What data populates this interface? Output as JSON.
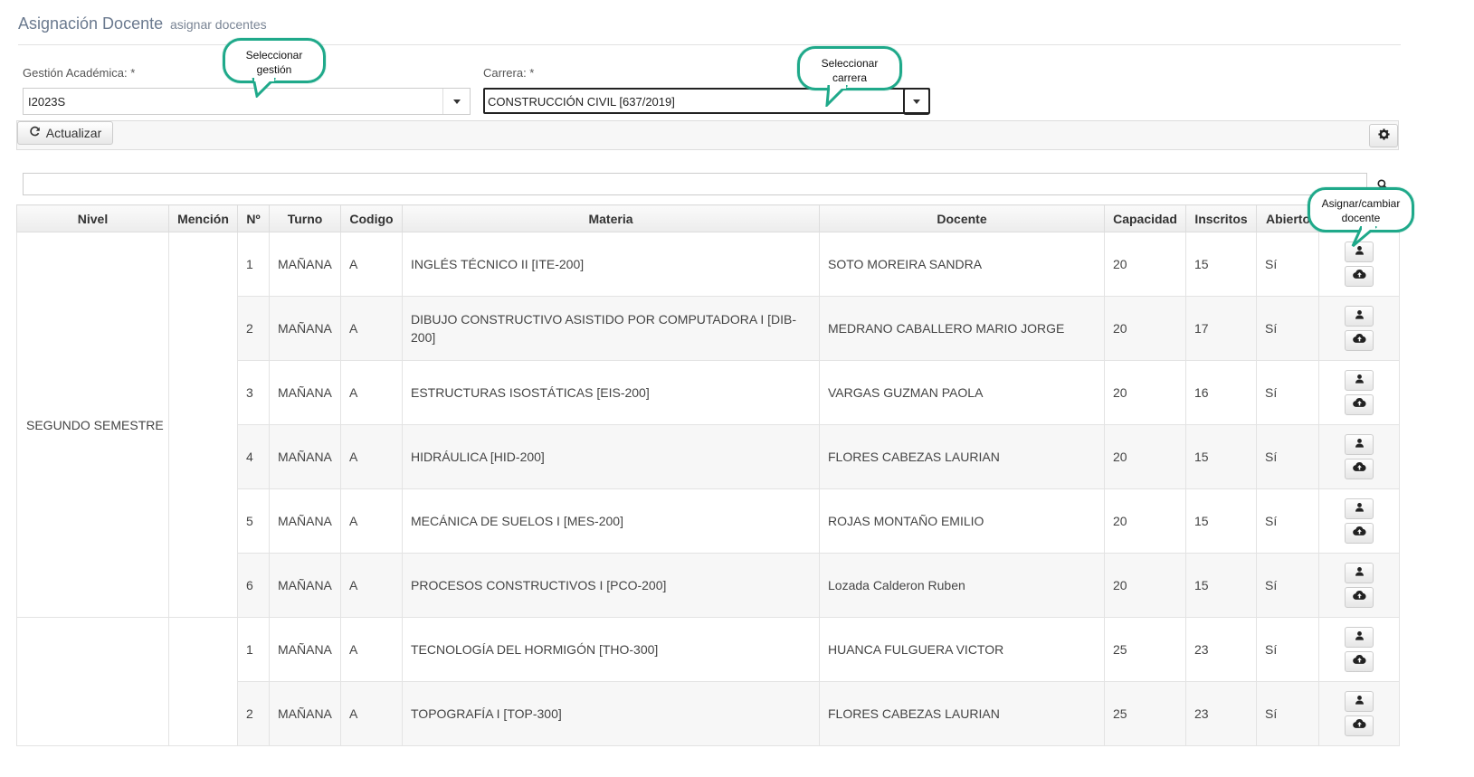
{
  "header": {
    "title": "Asignación Docente",
    "subtitle": "asignar docentes"
  },
  "form": {
    "gestion_label": "Gestión Académica:  *",
    "gestion_value": "I2023S",
    "carrera_label": "Carrera:  *",
    "carrera_value": "CONSTRUCCIÓN CIVIL [637/2019]"
  },
  "toolbar": {
    "refresh_label": "Actualizar",
    "refresh_icon": "refresh-icon",
    "settings_icon": "gear-icon"
  },
  "search": {
    "value": "",
    "icon": "search-icon"
  },
  "table": {
    "columns": [
      "Nivel",
      "Mención",
      "Nº",
      "Turno",
      "Codigo",
      "Materia",
      "Docente",
      "Capacidad",
      "Inscritos",
      "Abierto"
    ],
    "groups": [
      {
        "nivel": "SEGUNDO SEMESTRE",
        "mencion": "",
        "rows": [
          {
            "n": "1",
            "turno": "MAÑANA",
            "codigo": "A",
            "materia": "INGLÉS TÉCNICO II [ITE-200]",
            "docente": "SOTO MOREIRA SANDRA",
            "capacidad": "20",
            "inscritos": "15",
            "abierto": "Sí"
          },
          {
            "n": "2",
            "turno": "MAÑANA",
            "codigo": "A",
            "materia": "DIBUJO CONSTRUCTIVO ASISTIDO POR COMPUTADORA I [DIB-200]",
            "docente": "MEDRANO CABALLERO MARIO JORGE",
            "capacidad": "20",
            "inscritos": "17",
            "abierto": "Sí"
          },
          {
            "n": "3",
            "turno": "MAÑANA",
            "codigo": "A",
            "materia": "ESTRUCTURAS ISOSTÁTICAS [EIS-200]",
            "docente": "VARGAS GUZMAN PAOLA",
            "capacidad": "20",
            "inscritos": "16",
            "abierto": "Sí"
          },
          {
            "n": "4",
            "turno": "MAÑANA",
            "codigo": "A",
            "materia": "HIDRÁULICA [HID-200]",
            "docente": "FLORES CABEZAS LAURIAN",
            "capacidad": "20",
            "inscritos": "15",
            "abierto": "Sí"
          },
          {
            "n": "5",
            "turno": "MAÑANA",
            "codigo": "A",
            "materia": "MECÁNICA DE SUELOS I [MES-200]",
            "docente": "ROJAS MONTAÑO EMILIO",
            "capacidad": "20",
            "inscritos": "15",
            "abierto": "Sí"
          },
          {
            "n": "6",
            "turno": "MAÑANA",
            "codigo": "A",
            "materia": "PROCESOS CONSTRUCTIVOS I [PCO-200]",
            "docente": "Lozada Calderon Ruben",
            "capacidad": "20",
            "inscritos": "15",
            "abierto": "Sí"
          }
        ]
      },
      {
        "nivel": "",
        "mencion": "",
        "rows": [
          {
            "n": "1",
            "turno": "MAÑANA",
            "codigo": "A",
            "materia": "TECNOLOGÍA DEL HORMIGÓN [THO-300]",
            "docente": "HUANCA FULGUERA VICTOR",
            "capacidad": "25",
            "inscritos": "23",
            "abierto": "Sí"
          },
          {
            "n": "2",
            "turno": "MAÑANA",
            "codigo": "A",
            "materia": "TOPOGRAFÍA I [TOP-300]",
            "docente": "FLORES CABEZAS LAURIAN",
            "capacidad": "25",
            "inscritos": "23",
            "abierto": "Sí"
          }
        ]
      }
    ],
    "row_action_icons": [
      "user-icon",
      "cloud-upload-icon"
    ]
  },
  "callouts": {
    "gestion": "Seleccionar gestión",
    "carrera": "Seleccionar carrera",
    "docente": "Asignar/cambiar docente"
  },
  "colors": {
    "callout_border": "#1fa98a",
    "title": "#6b7a8f"
  }
}
